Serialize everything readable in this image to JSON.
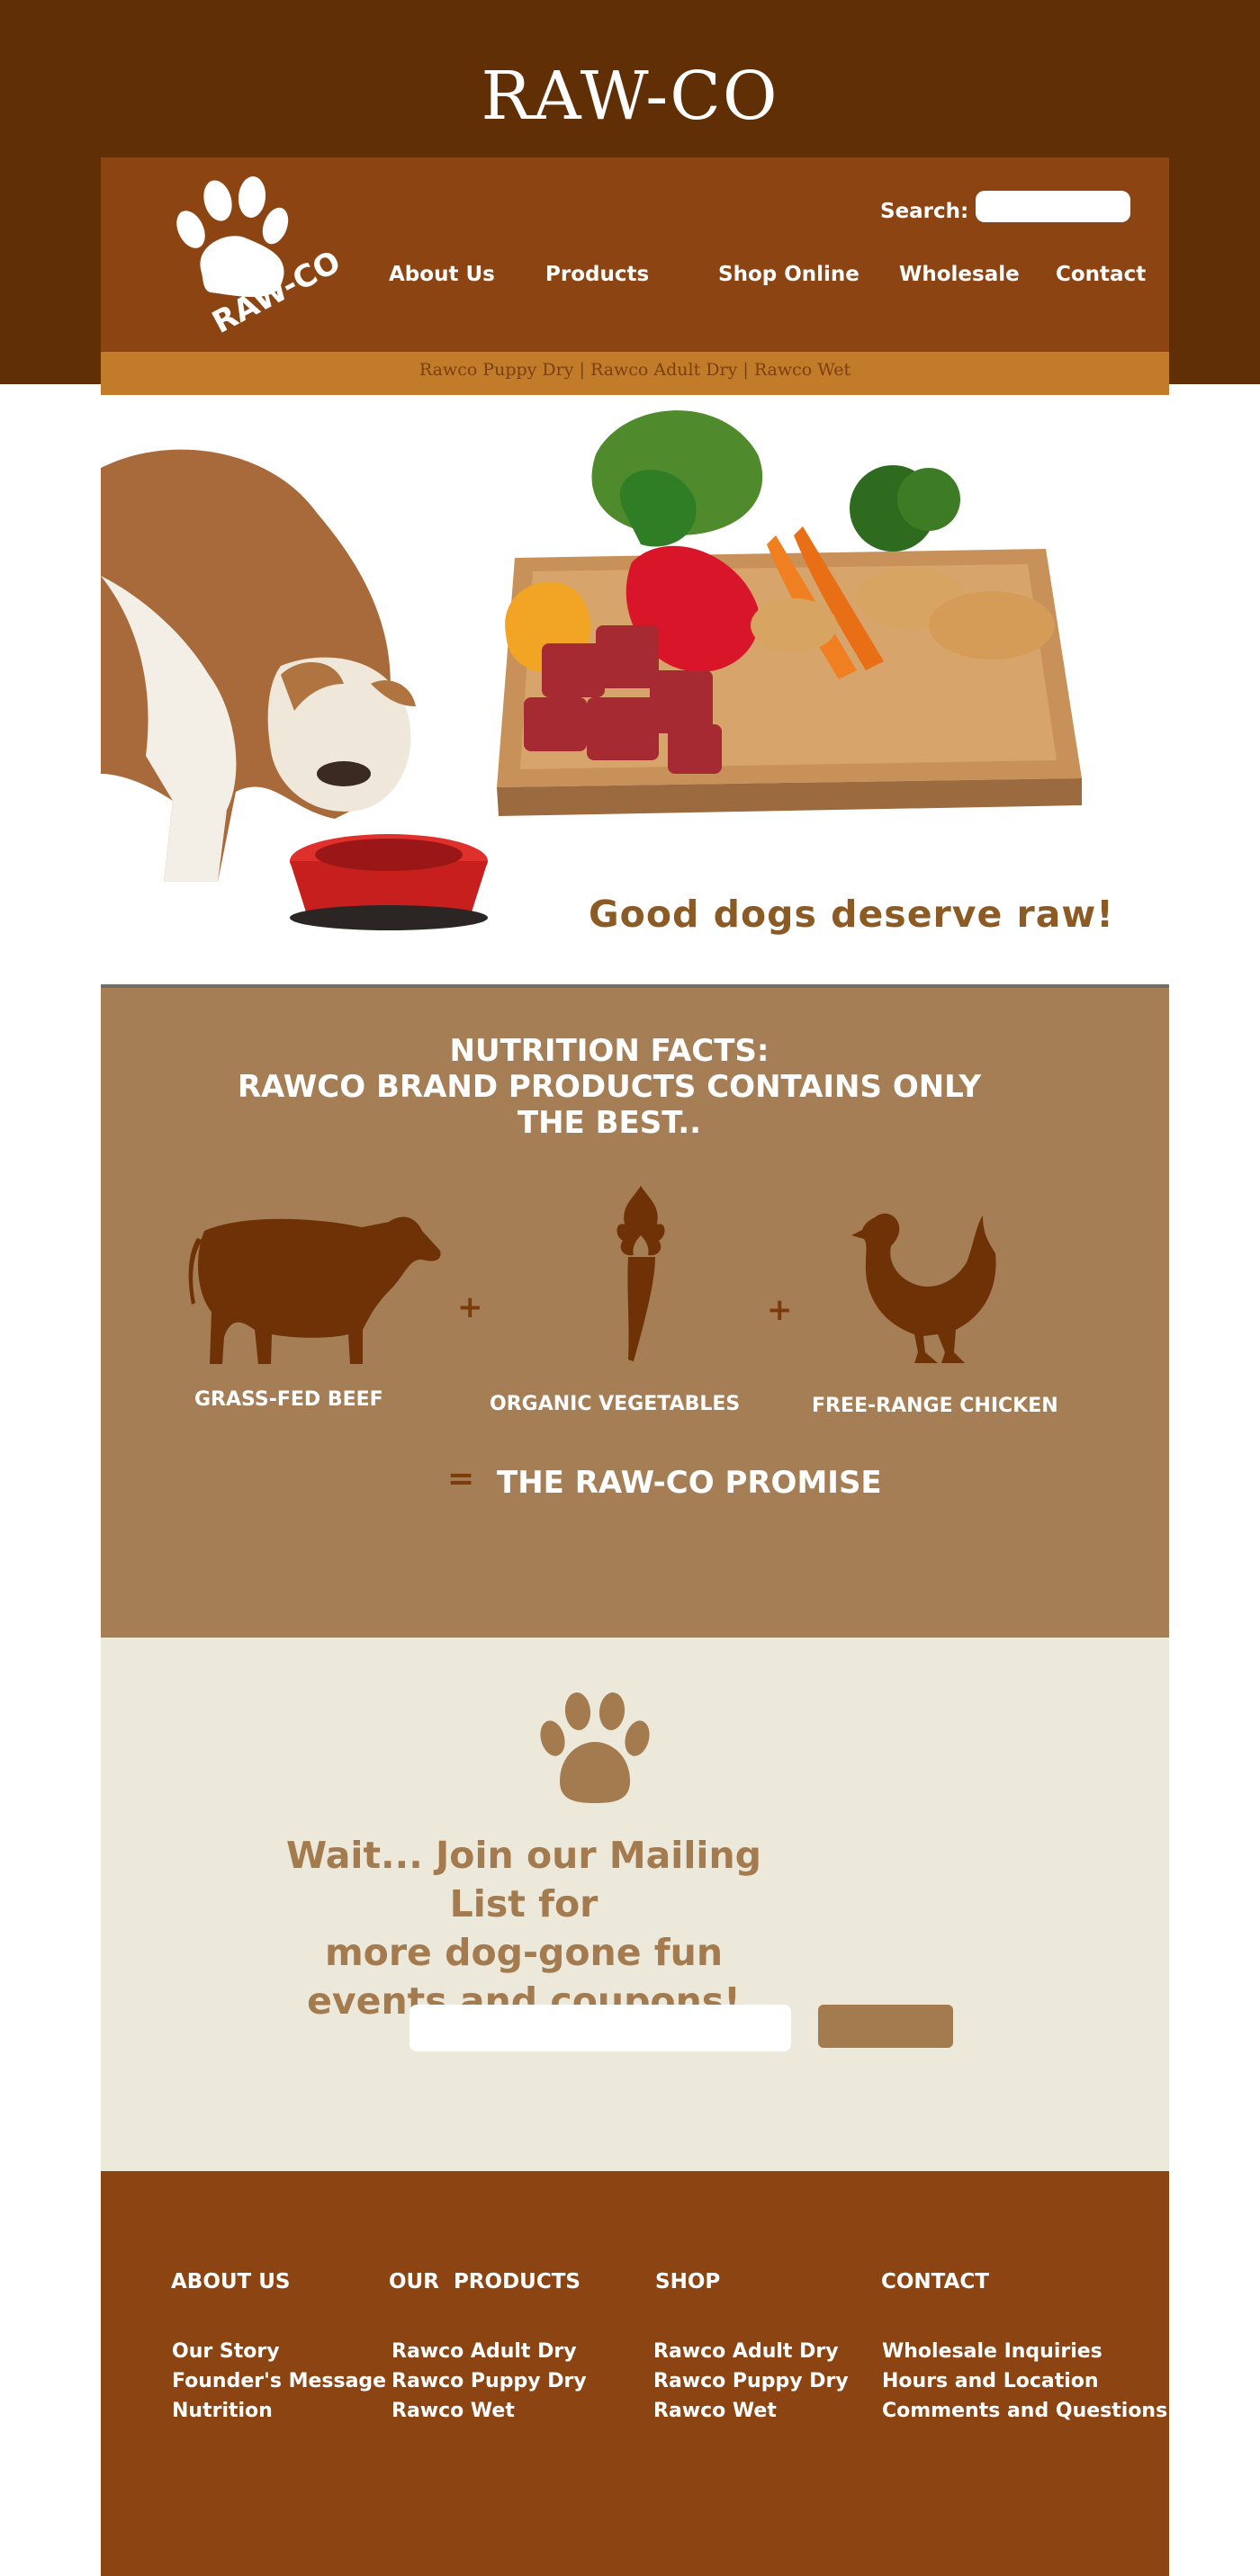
{
  "header": {
    "site_title": "RAW-CO",
    "logo_text": "RAW-CO",
    "search_label": "Search:",
    "search_value": "",
    "nav": [
      "About Us",
      "Products",
      "Shop Online",
      "Wholesale",
      "Contact"
    ],
    "subnav": [
      "Rawco Puppy Dry",
      "Rawco Adult Dry",
      "Rawco Wet"
    ],
    "subnav_text": "Rawco Puppy Dry | Rawco Adult Dry | Rawco Wet"
  },
  "hero": {
    "tagline": "Good dogs deserve raw!"
  },
  "nutrition": {
    "heading_lines": [
      "NUTRITION FACTS:",
      "RAWCO BRAND PRODUCTS CONTAINS ONLY",
      "THE BEST.."
    ],
    "items": [
      {
        "label": "GRASS-FED BEEF",
        "icon": "cow-icon"
      },
      {
        "label": "ORGANIC VEGETABLES",
        "icon": "carrot-icon"
      },
      {
        "label": "FREE-RANGE CHICKEN",
        "icon": "chicken-icon"
      }
    ],
    "plus": "+",
    "equals": "=",
    "promise": "THE RAW-CO PROMISE"
  },
  "mailing": {
    "icon": "paw-icon",
    "heading_lines": [
      "Wait... Join our Mailing List for",
      "more dog-gone fun",
      "events and coupons!"
    ],
    "email_value": "",
    "submit_label": ""
  },
  "footer": {
    "columns": [
      {
        "heading": "ABOUT US",
        "links": [
          "Our Story",
          "Founder's Message",
          "Nutrition"
        ]
      },
      {
        "heading": "OUR  PRODUCTS",
        "links": [
          "Rawco Adult Dry",
          "Rawco Puppy Dry",
          "Rawco Wet"
        ]
      },
      {
        "heading": "SHOP",
        "links": [
          "Rawco Adult Dry",
          "Rawco Puppy Dry",
          "Rawco Wet"
        ]
      },
      {
        "heading": "CONTACT",
        "links": [
          "Wholesale Inquiries",
          "Hours and Location",
          "Comments and Questions"
        ]
      }
    ]
  },
  "colors": {
    "top_band": "#612f06",
    "nav_panel": "#8c4412",
    "subnav": "#c27c29",
    "nutrition_bg": "#a57e56",
    "icon_brown": "#6e3206",
    "mailing_bg": "#ece8da",
    "accent_tan": "#a47a4f"
  }
}
